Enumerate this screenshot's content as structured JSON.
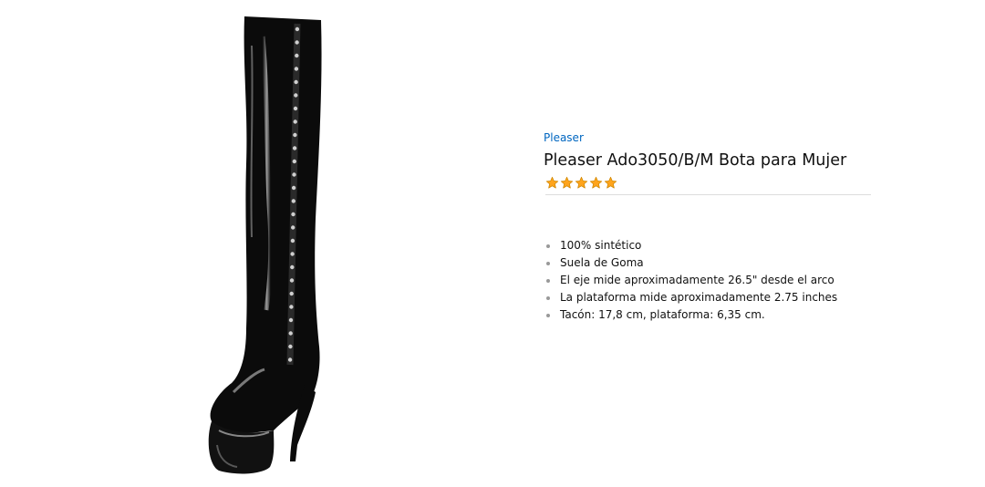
{
  "product": {
    "brand": "Pleaser",
    "title": "Pleaser Ado3050/B/M Bota para Mujer",
    "rating_icons": [
      "star-filled-icon",
      "star-filled-icon",
      "star-filled-icon",
      "star-filled-icon",
      "star-filled-icon"
    ],
    "rating_value": 5,
    "rating_max": 5,
    "image_icon": "thigh-high-lace-up-boot-icon",
    "bullets": [
      "100% sintético",
      "Suela de Goma",
      "El eje mide aproximadamente 26.5\" desde el arco",
      "La plataforma mide aproximadamente 2.75 inches",
      "Tacón: 17,8 cm, plataforma: 6,35 cm."
    ]
  },
  "colors": {
    "brand_link": "#0066c0",
    "star_fill": "#ffa41c",
    "star_stroke": "#d08700",
    "divider": "#dddddd",
    "boot": "#0b0b0b"
  }
}
